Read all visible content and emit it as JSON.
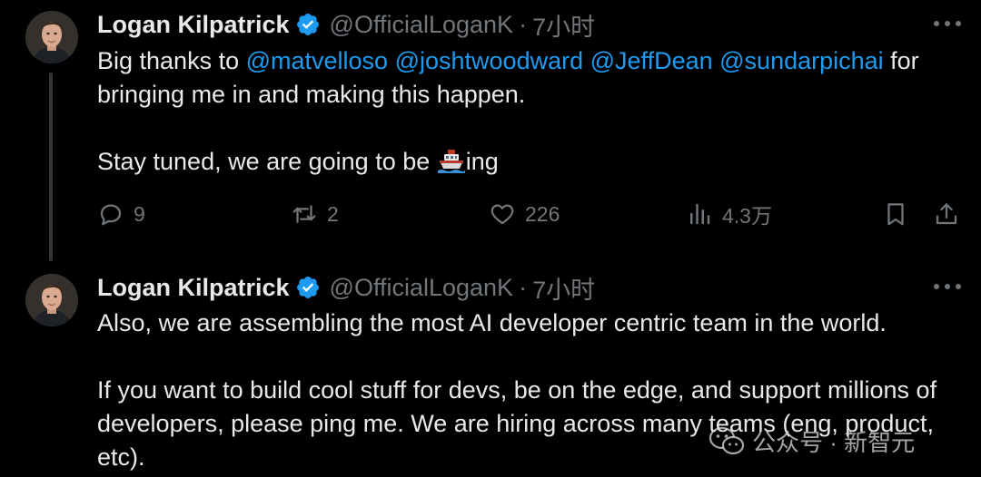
{
  "colors": {
    "background": "#000000",
    "text": "#e7e9ea",
    "muted": "#71767b",
    "mention": "#1d9bf0",
    "verified": "#1d9bf0",
    "thread_line": "#333639"
  },
  "tweets": [
    {
      "author": {
        "name": "Logan Kilpatrick",
        "handle": "@OfficialLoganK",
        "time": "7小时"
      },
      "text": {
        "p1_start": "Big thanks to ",
        "mentions": [
          "@matvelloso",
          "@joshtwoodward",
          "@JeffDean",
          "@sundarpichai"
        ],
        "p1_end": " for bringing me in and making this happen.",
        "p2_start": "Stay tuned, we are going to be ",
        "p2_emoji": "ship-emoji",
        "p2_end": "ing"
      },
      "stats": {
        "replies": "9",
        "retweets": "2",
        "likes": "226",
        "views": "4.3万"
      }
    },
    {
      "author": {
        "name": "Logan Kilpatrick",
        "handle": "@OfficialLoganK",
        "time": "7小时"
      },
      "text": {
        "p1": "Also, we are assembling the most AI developer centric team in the world.",
        "p2": "If you want to build cool stuff for devs, be on the edge, and support millions of developers, please ping me. We are hiring across many teams (eng, product, etc)."
      }
    }
  ],
  "icons": {
    "reply": "reply-icon",
    "retweet": "retweet-icon",
    "like": "heart-icon",
    "views": "views-chart-icon",
    "bookmark": "bookmark-icon",
    "share": "share-icon",
    "more": "more-icon",
    "verified": "verified-badge-icon"
  },
  "watermark": {
    "label": "公众号 · 新智元",
    "icon": "wechat-icon"
  }
}
